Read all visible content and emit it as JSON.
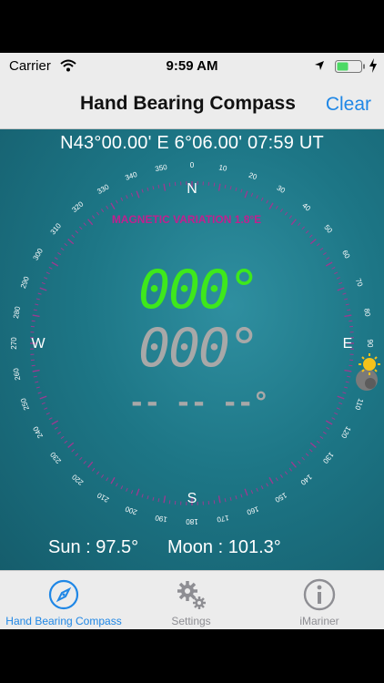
{
  "status_bar": {
    "carrier": "Carrier",
    "time": "9:59 AM",
    "icons": [
      "wifi-icon",
      "location-icon",
      "battery-icon",
      "charging-icon"
    ]
  },
  "nav": {
    "title": "Hand Bearing Compass",
    "clear_label": "Clear"
  },
  "compass": {
    "position": "N43°00.00' E 6°06.00' 07:59 UT",
    "magnetic_variation": "MAGNETIC VARIATION 1.8°E",
    "bearing_primary": "000°",
    "bearing_secondary": "000°",
    "bearing_tertiary": "-- -- --°",
    "cardinals": {
      "n": "N",
      "e": "E",
      "s": "S",
      "w": "W"
    },
    "ring_labels": [
      "0",
      "10",
      "20",
      "30",
      "40",
      "50",
      "60",
      "70",
      "80",
      "90",
      "100",
      "110",
      "120",
      "130",
      "140",
      "150",
      "160",
      "170",
      "180",
      "190",
      "200",
      "210",
      "220",
      "230",
      "240",
      "250",
      "260",
      "270",
      "280",
      "290",
      "300",
      "310",
      "320",
      "330",
      "340",
      "350"
    ],
    "sun_label": "Sun : 97.5°",
    "moon_label": "Moon : 101.3°",
    "colors": {
      "primary_digits": "#3ee81c",
      "secondary_digits": "#a8a8a8",
      "variation": "#c0208f",
      "ring": "#9b3a90"
    }
  },
  "tabs": [
    {
      "label": "Hand Bearing Compass",
      "icon": "compass-icon",
      "active": true
    },
    {
      "label": "Settings",
      "icon": "gear-icon",
      "active": false
    },
    {
      "label": "iMariner",
      "icon": "info-icon",
      "active": false
    }
  ],
  "colors": {
    "accent": "#1f87e6",
    "bar_bg": "#ececec",
    "inactive_tab": "#8e8e93"
  }
}
